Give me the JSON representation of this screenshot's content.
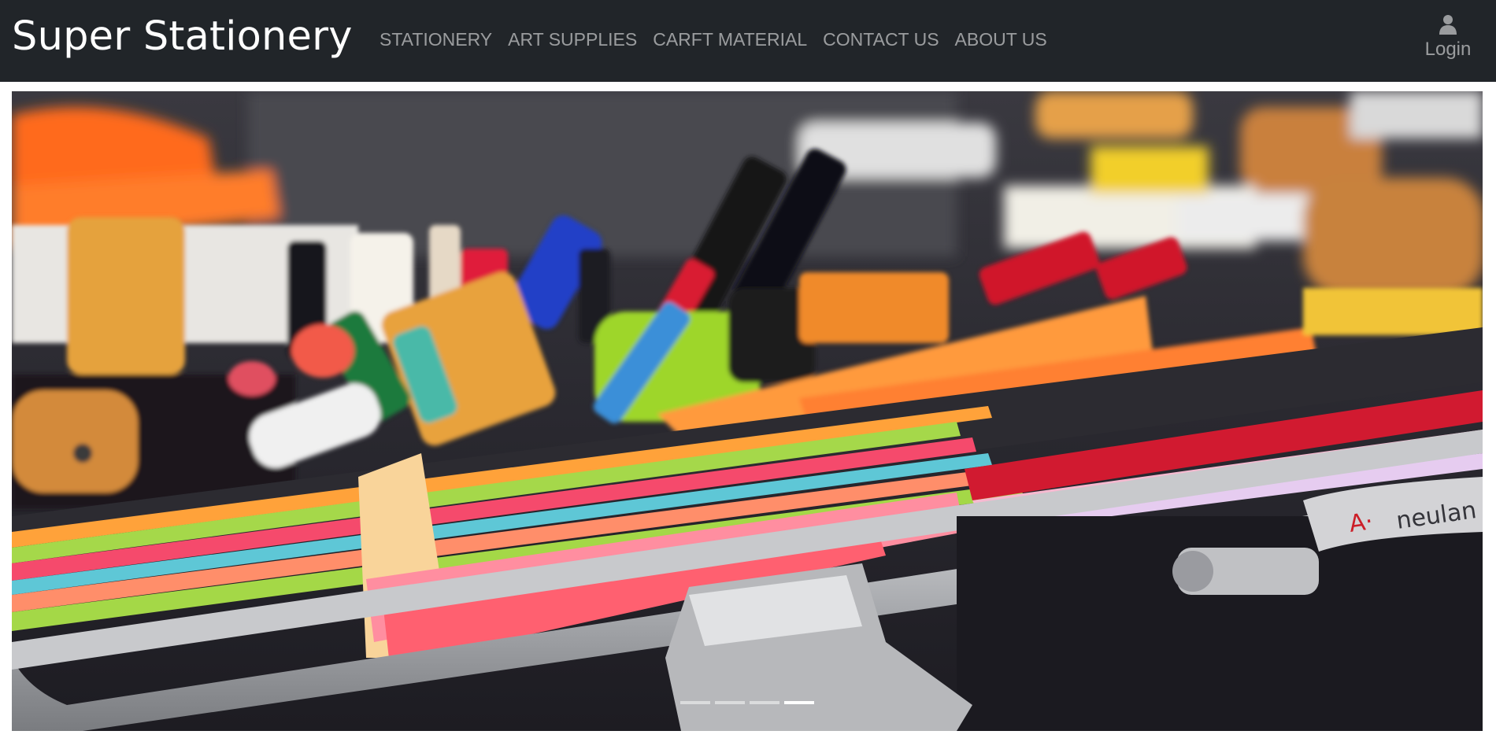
{
  "brand": "Super Stationery",
  "nav": {
    "items": [
      {
        "label": "STATIONERY"
      },
      {
        "label": "ART SUPPLIES"
      },
      {
        "label": "CARFT MATERIAL"
      },
      {
        "label": "CONTACT US"
      },
      {
        "label": "ABOUT US"
      }
    ],
    "login_label": "Login",
    "login_icon": "user-icon"
  },
  "carousel": {
    "slide_image": "stationery-case-photo",
    "indicator_count": 4,
    "active_indicator": 4,
    "case_label": "neulan"
  },
  "colors": {
    "navbar_bg": "#212529",
    "nav_text": "rgba(255,255,255,0.55)",
    "brand_text": "#ffffff"
  }
}
